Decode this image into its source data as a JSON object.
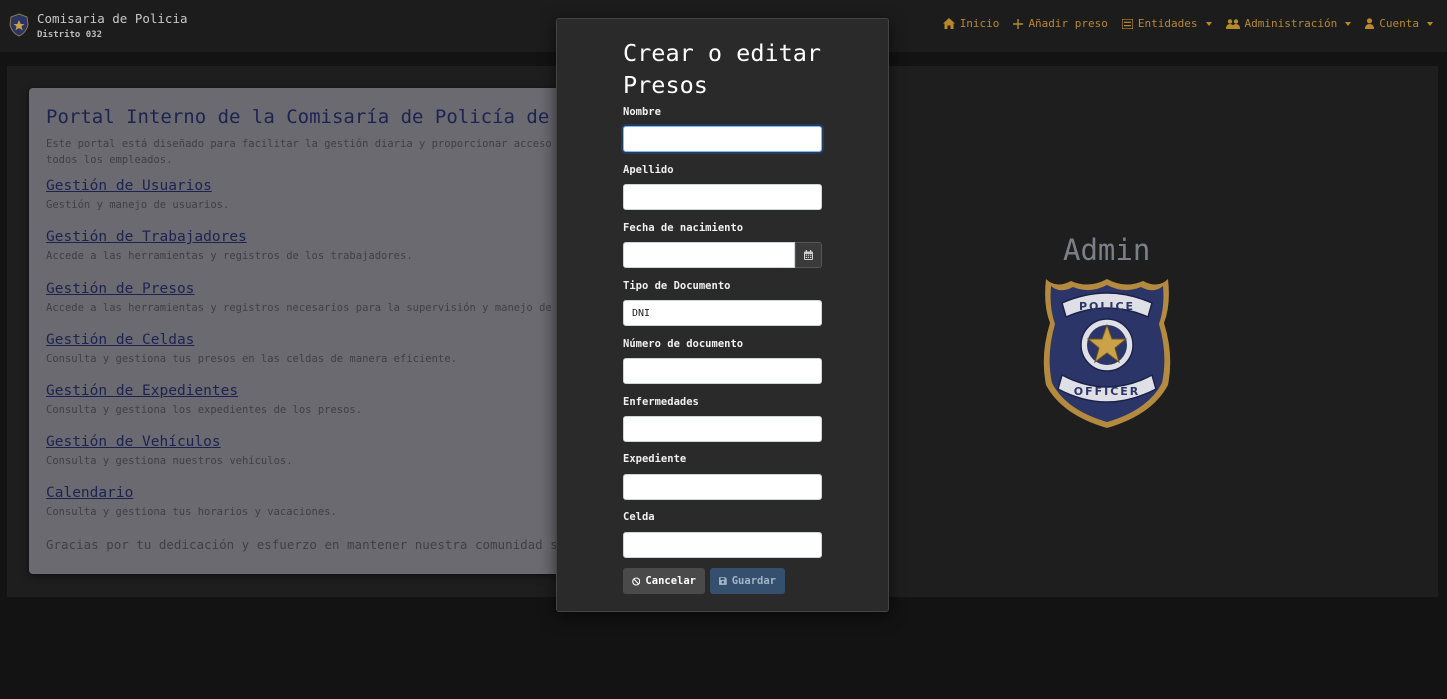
{
  "navbar": {
    "brand_title": "Comisaria de Policia",
    "brand_subtitle": "Distrito 032",
    "accent_color": "#b8892a",
    "links": [
      {
        "label": "Inicio",
        "icon": "home-icon"
      },
      {
        "label": "Añadir preso",
        "icon": "plus-icon"
      },
      {
        "label": "Entidades",
        "icon": "list-icon",
        "dropdown": true
      },
      {
        "label": "Administración",
        "icon": "users-icon",
        "dropdown": true
      },
      {
        "label": "Cuenta",
        "icon": "user-icon",
        "dropdown": true
      }
    ]
  },
  "portal": {
    "title": "Portal Interno de la Comisaría de Policía de",
    "intro_line1": "Este portal está diseñado para facilitar la gestión diaria y proporcionar acceso rápido",
    "intro_line2": "todos los empleados.",
    "sections": [
      {
        "title": "Gestión de Usuarios",
        "desc": "Gestión y manejo de usuarios."
      },
      {
        "title": "Gestión de Trabajadores",
        "desc": "Accede a las herramientas y registros de los trabajadores."
      },
      {
        "title": "Gestión de Presos",
        "desc": "Accede a las herramientas y registros necesarios para la supervisión y manejo de los de"
      },
      {
        "title": "Gestión de Celdas",
        "desc": "Consulta y gestiona tus presos en las celdas de manera eficiente."
      },
      {
        "title": "Gestión de Expedientes",
        "desc": "Consulta y gestiona los expedientes de los presos."
      },
      {
        "title": "Gestión de Vehículos",
        "desc": "Consulta y gestiona nuestros vehículos."
      },
      {
        "title": "Calendario",
        "desc": "Consulta y gestiona tus horarios y vacaciones."
      }
    ],
    "thanks": "Gracias por tu dedicación y esfuerzo en mantener nuestra comunidad seg"
  },
  "profile": {
    "name": "Admin",
    "badge_top_text": "POLICE",
    "badge_bottom_text": "OFFICER"
  },
  "modal": {
    "title": "Crear o editar Presos",
    "fields": {
      "nombre": {
        "label": "Nombre",
        "value": ""
      },
      "apellido": {
        "label": "Apellido",
        "value": ""
      },
      "fecha": {
        "label": "Fecha de nacimiento",
        "value": ""
      },
      "tipo_documento": {
        "label": "Tipo de Documento",
        "value": "DNI"
      },
      "numero_documento": {
        "label": "Número de documento",
        "value": ""
      },
      "enfermedades": {
        "label": "Enfermedades",
        "value": ""
      },
      "expediente": {
        "label": "Expediente",
        "value": ""
      },
      "celda": {
        "label": "Celda",
        "value": ""
      }
    },
    "cancel_label": "Cancelar",
    "save_label": "Guardar"
  }
}
